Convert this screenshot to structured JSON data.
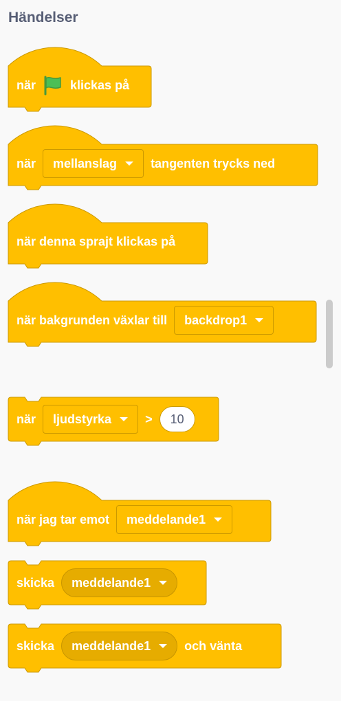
{
  "palette": {
    "category_title": "Händelser",
    "colors": {
      "block_fill": "#ffbf00",
      "block_border": "#cc9900",
      "text": "#ffffff",
      "title": "#575e75",
      "flag": "#4cbf56"
    },
    "blocks": {
      "flag_clicked": {
        "prefix": "när",
        "icon": "green-flag-icon",
        "suffix": "klickas på"
      },
      "key_pressed": {
        "prefix": "när",
        "key_value": "mellanslag",
        "suffix": "tangenten trycks ned"
      },
      "sprite_clicked": {
        "label": "när denna sprajt klickas på"
      },
      "backdrop_switch": {
        "prefix": "när bakgrunden växlar till",
        "backdrop_value": "backdrop1"
      },
      "greater_than": {
        "prefix": "när",
        "sensor_value": "ljudstyrka",
        "operator": ">",
        "number_value": "10"
      },
      "receive": {
        "prefix": "när jag tar emot",
        "message_value": "meddelande1"
      },
      "broadcast": {
        "prefix": "skicka",
        "message_value": "meddelande1"
      },
      "broadcast_wait": {
        "prefix": "skicka",
        "message_value": "meddelande1",
        "suffix": "och vänta"
      }
    }
  }
}
